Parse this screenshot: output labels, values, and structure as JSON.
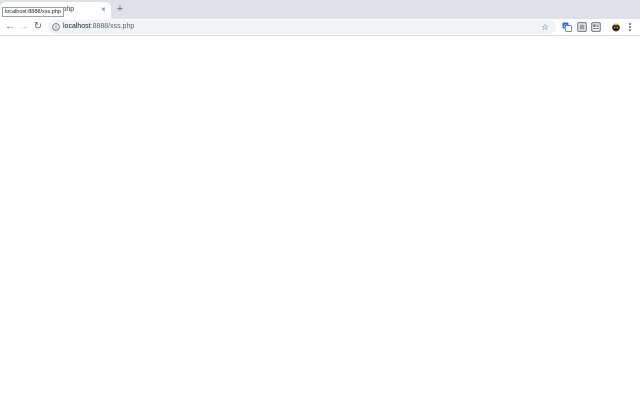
{
  "tab": {
    "title": "xss.php",
    "close_glyph": "×",
    "new_tab_glyph": "+"
  },
  "tooltip": {
    "text": "localhost:8888/xss.php"
  },
  "toolbar": {
    "back_glyph": "←",
    "forward_glyph": "→",
    "reload_glyph": "↻"
  },
  "omnibox": {
    "url_host": "localhost",
    "url_rest": ":8888/xss.php",
    "star_glyph": "☆"
  },
  "extensions": [
    {
      "icon": "translate-icon"
    },
    {
      "icon": "screenshot-icon"
    },
    {
      "icon": "reader-icon"
    },
    {
      "icon": "profile-avatar-icon"
    }
  ],
  "colors": {
    "tabstrip_bg": "#dee1e6",
    "omnibox_bg": "#f1f3f4",
    "icon_gray": "#5f6368",
    "translate_blue": "#1a73e8"
  }
}
